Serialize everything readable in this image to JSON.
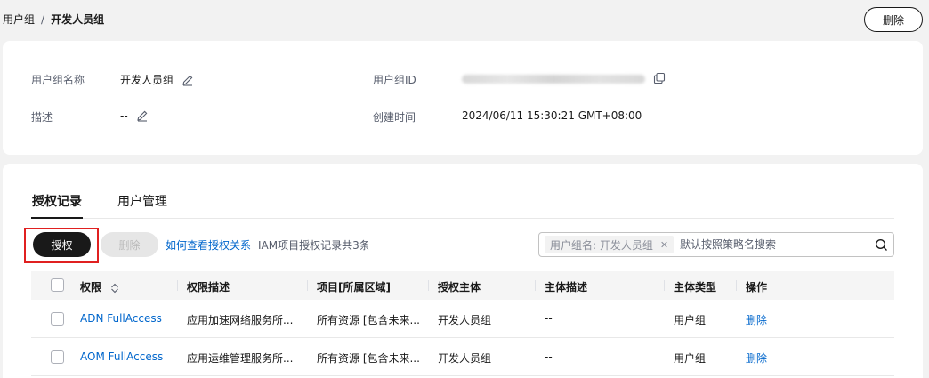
{
  "breadcrumb": {
    "parent": "用户组",
    "separator": "/",
    "current": "开发人员组"
  },
  "top_actions": {
    "delete_label": "删除"
  },
  "info": {
    "name_label": "用户组名称",
    "name_value": "开发人员组",
    "id_label": "用户组ID",
    "desc_label": "描述",
    "desc_value": "--",
    "created_label": "创建时间",
    "created_value": "2024/06/11 15:30:21 GMT+08:00"
  },
  "tabs": [
    {
      "label": "授权记录",
      "active": true
    },
    {
      "label": "用户管理",
      "active": false
    }
  ],
  "toolbar": {
    "grant_label": "授权",
    "delete_label": "删除",
    "how_link": "如何查看授权关系",
    "count_text": "IAM项目授权记录共3条"
  },
  "search": {
    "tag": "用户组名: 开发人员组",
    "placeholder": "默认按照策略名搜索"
  },
  "table": {
    "headers": [
      "权限",
      "权限描述",
      "项目[所属区域]",
      "授权主体",
      "主体描述",
      "主体类型",
      "操作"
    ],
    "rows": [
      {
        "permission": "ADN FullAccess",
        "desc": "应用加速网络服务所...",
        "project": "所有资源 [包含未来...",
        "principal": "开发人员组",
        "principal_desc": "--",
        "type": "用户组",
        "action": "删除"
      },
      {
        "permission": "AOM FullAccess",
        "desc": "应用运维管理服务所...",
        "project": "所有资源 [包含未来...",
        "principal": "开发人员组",
        "principal_desc": "--",
        "type": "用户组",
        "action": "删除"
      }
    ]
  },
  "colors": {
    "link": "#0066cc",
    "highlight": "#e02020",
    "primary": "#191919"
  }
}
